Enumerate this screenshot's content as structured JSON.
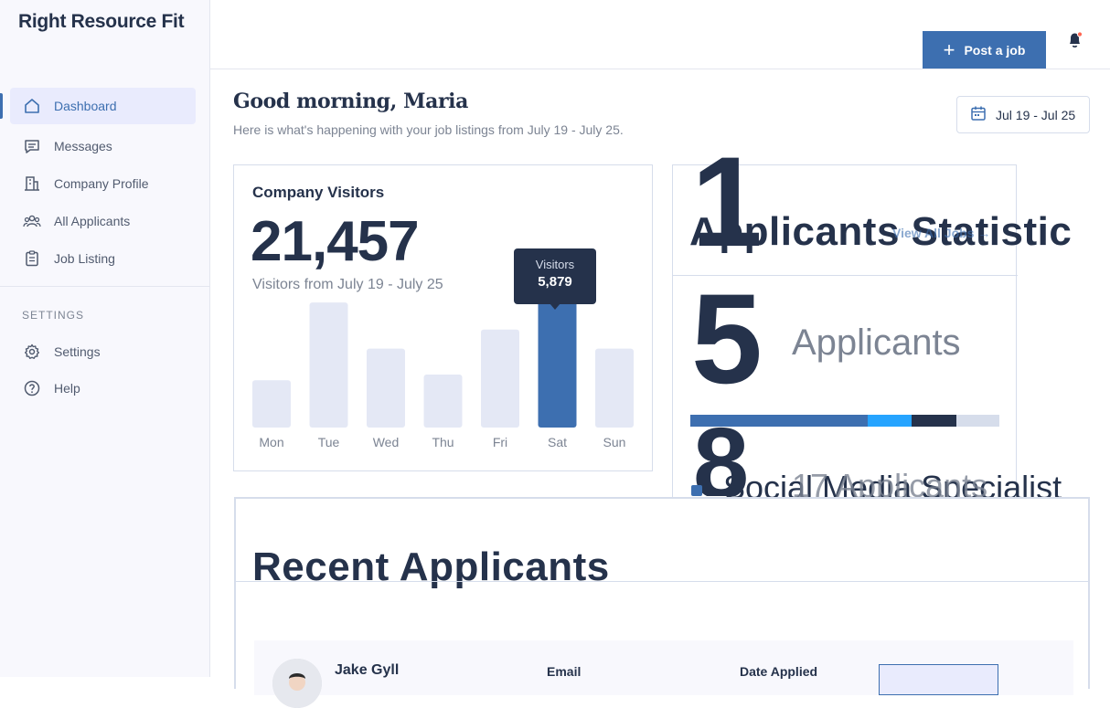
{
  "brand": "Right Resource Fit",
  "sidebar": {
    "items": [
      {
        "label": "Dashboard",
        "icon": "home-icon",
        "active": true
      },
      {
        "label": "Messages",
        "icon": "message-icon"
      },
      {
        "label": "Company Profile",
        "icon": "building-icon"
      },
      {
        "label": "All Applicants",
        "icon": "users-icon"
      },
      {
        "label": "Job Listing",
        "icon": "clipboard-icon"
      }
    ],
    "settings_heading": "SETTINGS",
    "settings_items": [
      {
        "label": "Settings",
        "icon": "gear-icon"
      },
      {
        "label": "Help",
        "icon": "help-icon"
      }
    ]
  },
  "topbar": {
    "post_job_label": "Post a job",
    "notification_dot_color": "#ff6550"
  },
  "header": {
    "greeting": "Good morning, Maria",
    "subtitle": "Here is what's happening with your job listings from July 19 - July 25.",
    "date_range": "Jul 19 - Jul 25"
  },
  "visitors": {
    "title": "Company Visitors",
    "total": "21,457",
    "subtitle": "Visitors from July 19 - July 25",
    "tooltip_label": "Visitors",
    "tooltip_value": "5,879",
    "colors": {
      "bar": "#e4e8f5",
      "highlight": "#3d6fb0"
    }
  },
  "chart_data": {
    "type": "bar",
    "categories": [
      "Mon",
      "Tue",
      "Wed",
      "Thu",
      "Fri",
      "Sat",
      "Sun"
    ],
    "values": [
      2100,
      5550,
      3500,
      2350,
      4350,
      5879,
      3500
    ],
    "highlight_index": 5,
    "title": "Company Visitors",
    "ylim": [
      0,
      6000
    ],
    "grid": false
  },
  "stats": {
    "title": "Applicants Statistic",
    "view_all": "View All Jobs",
    "big_one": "1",
    "big_five": "5",
    "applicants_label": "Applicants",
    "big_eight": "8",
    "role": "Social Media Specialist",
    "role_count": "17 Applicants",
    "segments": [
      {
        "fraction": 0.575,
        "color": "#3d6fb0"
      },
      {
        "fraction": 0.14,
        "color": "#26a4ff"
      },
      {
        "fraction": 0.145,
        "color": "#25324b"
      },
      {
        "fraction": 0.14,
        "color": "#d6ddeb"
      }
    ]
  },
  "recent": {
    "title": "Recent Applicants",
    "applicant": {
      "name": "Jake Gyll",
      "email_label": "Email",
      "date_label": "Date Applied"
    }
  }
}
